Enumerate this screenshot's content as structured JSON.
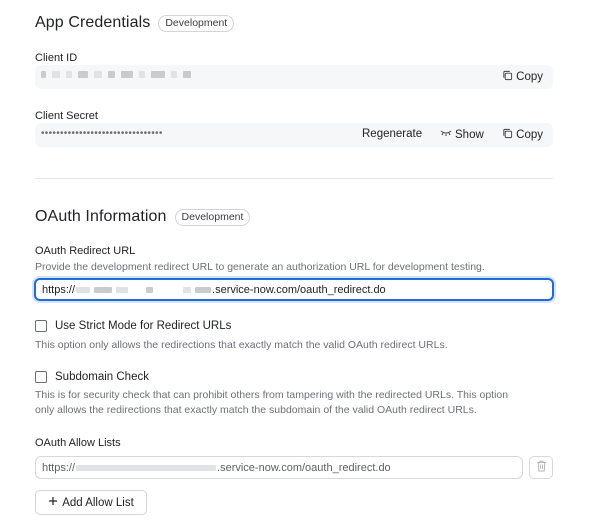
{
  "app_credentials": {
    "title": "App Credentials",
    "badge": "Development",
    "client_id": {
      "label": "Client ID",
      "copy_label": "Copy"
    },
    "client_secret": {
      "label": "Client Secret",
      "masked_value": "••••••••••••••••••••••••••••••••",
      "regenerate_label": "Regenerate",
      "show_label": "Show",
      "copy_label": "Copy"
    }
  },
  "oauth": {
    "title": "OAuth Information",
    "badge": "Development",
    "redirect_url": {
      "label": "OAuth Redirect URL",
      "help": "Provide the development redirect URL to generate an authorization URL for development testing.",
      "value_prefix": "https://",
      "value_suffix": ".service-now.com/oauth_redirect.do"
    },
    "strict_mode": {
      "label": "Use Strict Mode for Redirect URLs",
      "checked": false,
      "help": "This option only allows the redirections that exactly match the valid OAuth redirect URLs."
    },
    "subdomain_check": {
      "label": "Subdomain Check",
      "checked": false,
      "help_line1": "This is for security check that can prohibit others from tampering with the redirected URLs. This option",
      "help_line2": "only allows the redirections that exactly match the subdomain of the valid OAuth redirect URLs."
    },
    "allow_lists": {
      "label": "OAuth Allow Lists",
      "items": [
        {
          "value_prefix": "https://",
          "value_suffix": ".service-now.com/oauth_redirect.do"
        }
      ],
      "add_label": "Add Allow List"
    }
  },
  "icons": {
    "copy": "copy-icon",
    "show": "eye-closed-icon",
    "delete": "trash-icon",
    "add": "plus-icon"
  },
  "colors": {
    "focus_border": "#1f6bd8",
    "muted_text": "#6e7079",
    "readonly_bg": "#f6f7f9"
  }
}
